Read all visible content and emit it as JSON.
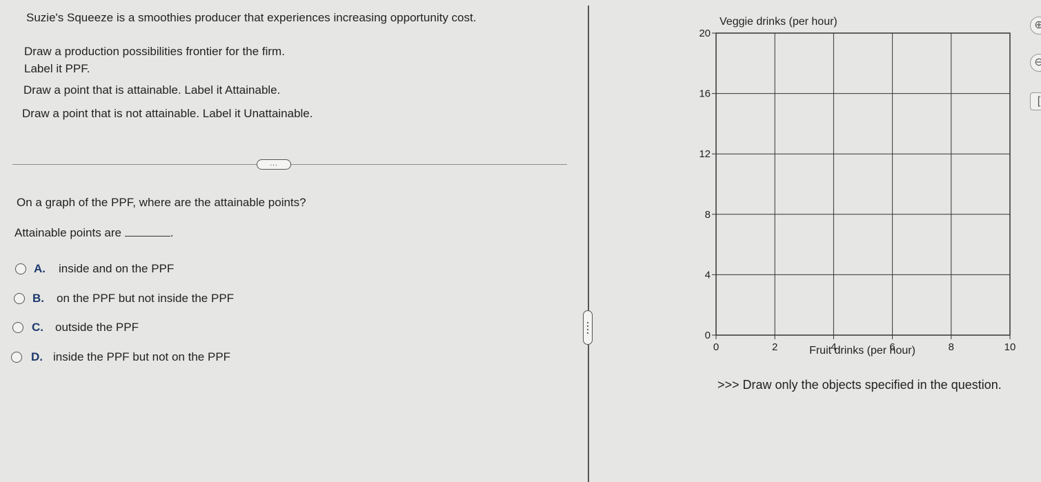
{
  "question": {
    "intro": "Suzie's Squeeze is a smoothies producer that experiences increasing opportunity cost.",
    "instruction_1": "Draw a production possibilities frontier for the firm.",
    "instruction_1b": "Label it PPF.",
    "instruction_2": "Draw a point that is attainable. Label it Attainable.",
    "instruction_3": "Draw a point that is not attainable. Label it Unattainable.",
    "sub_question": "On a graph of the PPF, where are the attainable points?",
    "prompt": "Attainable points are",
    "prompt_end": "."
  },
  "options": [
    {
      "letter": "A.",
      "text": "inside and on the PPF"
    },
    {
      "letter": "B.",
      "text": "on the PPF but not inside the PPF"
    },
    {
      "letter": "C.",
      "text": "outside the PPF"
    },
    {
      "letter": "D.",
      "text": "inside the PPF but not on the PPF"
    }
  ],
  "ellipsis": "...",
  "graph": {
    "y_label": "Veggie drinks (per hour)",
    "x_label": "Fruit drinks (per hour)",
    "x_ticks": [
      "0",
      "2",
      "4",
      "6",
      "8",
      "10"
    ],
    "y_ticks": [
      "0",
      "4",
      "8",
      "12",
      "16",
      "20"
    ],
    "x_range": [
      0,
      10
    ],
    "y_range": [
      0,
      20
    ],
    "grid": true,
    "grid_color": "#333333"
  },
  "footer_instruction": ">>> Draw only the objects specified in the question.",
  "tools": {
    "zoom_in": "⊕",
    "zoom_out": "⊖",
    "other": "["
  }
}
